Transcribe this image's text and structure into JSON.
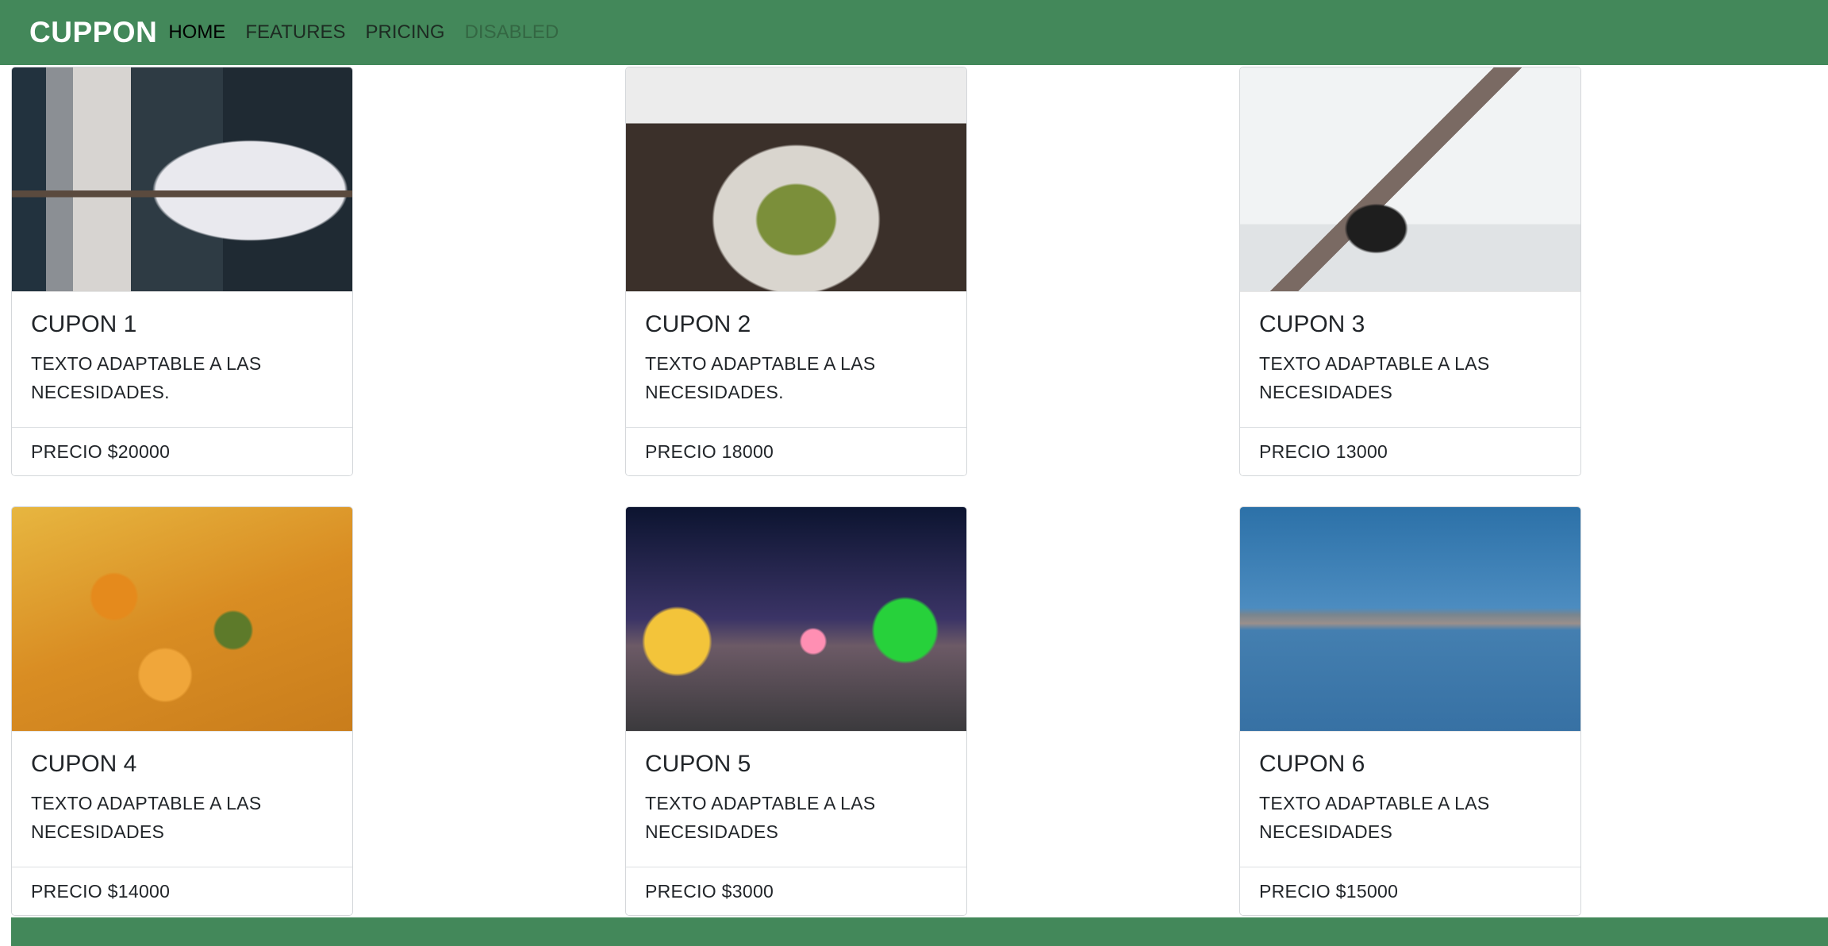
{
  "navbar": {
    "brand": "CUPPON",
    "links": [
      {
        "label": "HOME",
        "state": "active"
      },
      {
        "label": "FEATURES",
        "state": "normal"
      },
      {
        "label": "PRICING",
        "state": "normal"
      },
      {
        "label": "DISABLED",
        "state": "disabled"
      }
    ]
  },
  "colors": {
    "brand_green": "#43885a"
  },
  "cards": [
    {
      "title": "CUPON 1",
      "text": "TEXTO ADAPTABLE A LAS NECESIDADES.",
      "price": "PRECIO $20000",
      "image": "bedroom-photo"
    },
    {
      "title": "CUPON 2",
      "text": "TEXTO ADAPTABLE A LAS NECESIDADES.",
      "price": "PRECIO 18000",
      "image": "salad-photo"
    },
    {
      "title": "CUPON 3",
      "text": "TEXTO ADAPTABLE A LAS NECESIDADES",
      "price": "PRECIO 13000",
      "image": "dental-office-photo"
    },
    {
      "title": "CUPON 4",
      "text": "TEXTO ADAPTABLE A LAS NECESIDADES",
      "price": "PRECIO $14000",
      "image": "food-dish-photo"
    },
    {
      "title": "CUPON 5",
      "text": "TEXTO ADAPTABLE A LAS NECESIDADES",
      "price": "PRECIO $3000",
      "image": "carnival-photo"
    },
    {
      "title": "CUPON 6",
      "text": "TEXTO ADAPTABLE A LAS NECESIDADES",
      "price": "PRECIO $15000",
      "image": "lake-flamingo-photo"
    }
  ]
}
